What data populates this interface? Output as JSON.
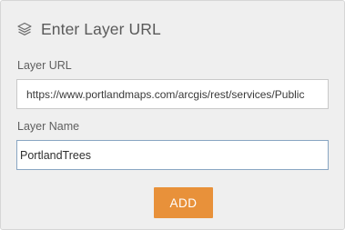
{
  "dialog": {
    "icon": "layers-icon",
    "title": "Enter Layer URL"
  },
  "layer_url": {
    "label": "Layer URL",
    "value": "https://www.portlandmaps.com/arcgis/rest/services/Public"
  },
  "layer_name": {
    "label": "Layer Name",
    "value": "PortlandTrees"
  },
  "actions": {
    "add_label": "ADD"
  },
  "colors": {
    "panel_background": "#efefef",
    "accent_button": "#e8913a",
    "focused_border": "#8aa6c3",
    "text": "#5a5a5a"
  }
}
